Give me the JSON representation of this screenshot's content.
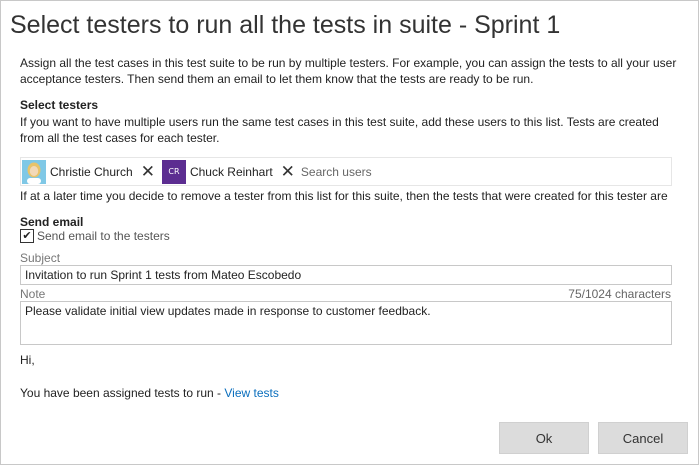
{
  "dialog": {
    "title": "Select testers to run all the tests in suite - Sprint 1",
    "intro": "Assign all the test cases in this test suite to be run by multiple testers. For example, you can assign the tests to all your user acceptance testers. Then send them an email to let them know that the tests are ready to be run."
  },
  "select_testers": {
    "heading": "Select testers",
    "description": "If you want to have multiple users run the same test cases in this test suite, add these users to this list. Tests are created from all the test cases for each tester.",
    "testers": [
      {
        "name": "Christie Church",
        "avatar": "photo",
        "remove_glyph": "✕"
      },
      {
        "name": "Chuck Reinhart",
        "avatar": "initials",
        "initials": "CR",
        "remove_glyph": "✕"
      }
    ],
    "search_placeholder": "Search users",
    "remove_note": "If at a later time you decide to remove a tester from this list for this suite, then the tests that were created for this tester are"
  },
  "send_email": {
    "heading": "Send email",
    "checkbox_label": "Send email to the testers",
    "checkbox_checked": true,
    "subject_label": "Subject",
    "subject_value": "Invitation to run Sprint 1 tests from Mateo Escobedo",
    "note_label": "Note",
    "char_count": "75/1024 characters",
    "note_value": "Please validate initial view updates made in response to customer feedback.",
    "greeting": "Hi,",
    "assigned_text": "You have been assigned tests to run - ",
    "view_tests_link": "View tests"
  },
  "buttons": {
    "ok": "Ok",
    "cancel": "Cancel"
  },
  "colors": {
    "link": "#0a6ebd",
    "initials_avatar_bg": "#5c2d91",
    "button_bg": "#dcdcdc"
  }
}
